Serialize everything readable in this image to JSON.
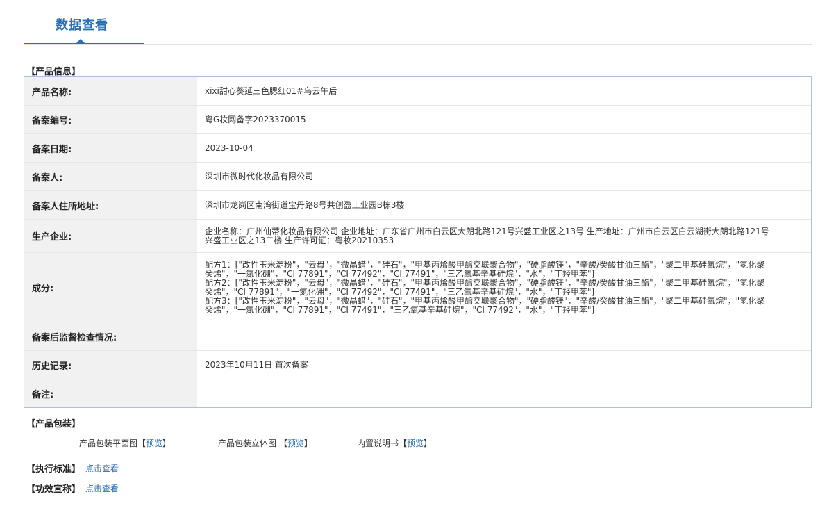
{
  "tab": {
    "title": "数据查看"
  },
  "product_info": {
    "heading": "【产品信息】",
    "rows": [
      {
        "label": "产品名称:",
        "value": "xixi甜心葵延三色腮红01#乌云午后"
      },
      {
        "label": "备案编号:",
        "value": "粤G妆网备字2023370015"
      },
      {
        "label": "备案日期:",
        "value": "2023-10-04"
      },
      {
        "label": "备案人:",
        "value": "深圳市微时代化妆品有限公司"
      },
      {
        "label": "备案人住所地址:",
        "value": "深圳市龙岗区南湾街道宝丹路8号共创盈工业园B栋3楼"
      },
      {
        "label": "生产企业:",
        "value": "企业名称：广州仙蒂化妆品有限公司 企业地址：广东省广州市白云区大朗北路121号兴盛工业区之13号 生产地址：广州市白云区白云湖街大朗北路121号兴盛工业区之13二楼 生产许可证：粤妆20210353"
      },
      {
        "label": "成分:",
        "lines": [
          "配方1：[\"改性玉米淀粉\"，\"云母\"，\"微晶蜡\"，\"硅石\"，\"甲基丙烯酸甲酯交联聚合物\"，\"硬脂酸镁\"，\"辛酸/癸酸甘油三酯\"，\"聚二甲基硅氧烷\"，\"氢化聚癸烯\"，\"一氮化硼\"，\"CI 77891\"，\"CI 77492\"，\"CI 77491\"，\"三乙氧基辛基硅烷\"，\"水\"，\"丁羟甲苯\"]",
          "配方2：[\"改性玉米淀粉\"，\"云母\"，\"微晶蜡\"，\"硅石\"，\"甲基丙烯酸甲酯交联聚合物\"，\"硬脂酸镁\"，\"辛酸/癸酸甘油三酯\"，\"聚二甲基硅氧烷\"，\"氢化聚癸烯\"，\"CI 77891\"，\"一氮化硼\"，\"CI 77492\"，\"CI 77491\"，\"三乙氧基辛基硅烷\"，\"水\"，\"丁羟甲苯\"]",
          "配方3：[\"改性玉米淀粉\"，\"云母\"，\"微晶蜡\"，\"硅石\"，\"甲基丙烯酸甲酯交联聚合物\"，\"硬脂酸镁\"，\"辛酸/癸酸甘油三酯\"，\"聚二甲基硅氧烷\"，\"氢化聚癸烯\"，\"一氮化硼\"，\"CI 77891\"，\"CI 77491\"，\"三乙氧基辛基硅烷\"，\"CI 77492\"，\"水\"，\"丁羟甲苯\"]"
        ]
      },
      {
        "label": "备案后监督检查情况:",
        "value": ""
      },
      {
        "label": "历史记录:",
        "value": "2023年10月11日 首次备案"
      },
      {
        "label": "备注:",
        "value": ""
      }
    ]
  },
  "packaging": {
    "heading": "【产品包装】",
    "items": [
      {
        "label": "产品包装平面图",
        "link": "预览"
      },
      {
        "label": "产品包装立体图 ",
        "link": "预览"
      },
      {
        "label": "内置说明书",
        "link": "预览"
      }
    ]
  },
  "standard": {
    "heading": "【执行标准】",
    "link": "点击查看"
  },
  "efficacy": {
    "heading": "【功效宣称】",
    "link": "点击查看"
  },
  "colors": {
    "accent": "#2a6fb2",
    "table_border": "#a9c1de",
    "label_bg": "#f1f1f1"
  }
}
